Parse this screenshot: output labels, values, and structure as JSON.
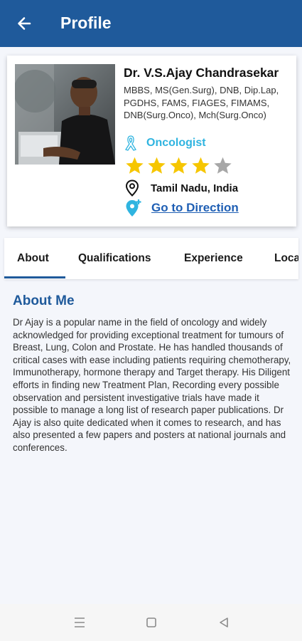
{
  "app_bar": {
    "title": "Profile",
    "back_icon": "arrow-left-icon"
  },
  "doctor": {
    "name": "Dr. V.S.Ajay Chandrasekar",
    "qualifications": "MBBS, MS(Gen.Surg), DNB, Dip.Lap, PGDHS, FAMS, FIAGES, FIMAMS, DNB(Surg.Onco), Mch(Surg.Onco)",
    "specialty": "Oncologist",
    "specialty_icon": "awareness-ribbon-icon",
    "rating": 4,
    "rating_max": 5,
    "location": "Tamil Nadu, India",
    "location_icon": "map-pin-icon",
    "direction_label": "Go to Direction",
    "direction_icon": "add-location-icon"
  },
  "tabs": [
    {
      "label": "About",
      "active": true
    },
    {
      "label": "Qualifications",
      "active": false
    },
    {
      "label": "Experience",
      "active": false
    },
    {
      "label": "Location",
      "active": false
    }
  ],
  "about": {
    "heading": "About Me",
    "body": "Dr Ajay is a popular name in the field of oncology and widely acknowledged for providing exceptional treatment for tumours of Breast, Lung, Colon and Prostate. He has handled thousands of critical cases with ease including patients requiring chemotherapy, Immunotherapy, hormone therapy and Target therapy. His Diligent efforts in finding new Treatment Plan, Recording every possible observation and persistent investigative trials have made it possible to manage a long list of research paper publications. Dr Ajay is also quite dedicated when it comes to research, and has also presented a few papers and posters at national journals and conferences."
  },
  "colors": {
    "primary": "#1f5a9b",
    "accent": "#2fb4e0",
    "star_filled": "#f6c600",
    "star_empty": "#a7a7a7",
    "link": "#1f5fb4"
  },
  "system_nav": {
    "icons": [
      "recent-apps-icon",
      "home-icon",
      "back-triangle-icon"
    ]
  }
}
